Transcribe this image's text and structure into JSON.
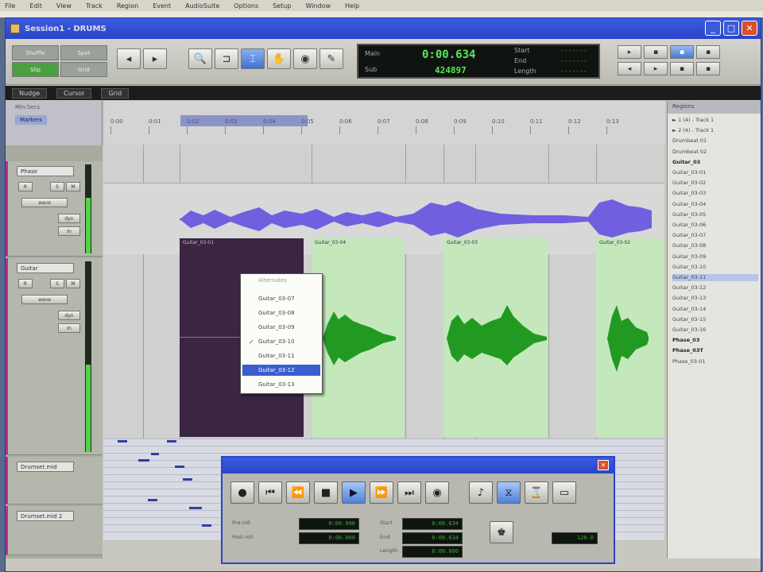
{
  "os_menu": [
    "File",
    "Edit",
    "View",
    "Track",
    "Region",
    "Event",
    "AudioSuite",
    "Options",
    "Setup",
    "Window",
    "Help"
  ],
  "window": {
    "title": "Session1 - DRUMS"
  },
  "toolbar": {
    "modes": [
      "Shuffle",
      "Spot",
      "Slip",
      "Grid"
    ],
    "counter_main_label": "Main",
    "counter_sub_label": "Sub",
    "counter_main": "0:00.634",
    "counter_sub": "424897",
    "start_label": "Start",
    "end_label": "End",
    "length_label": "Length"
  },
  "darkbar": {
    "items": [
      "Nudge",
      "Cursor",
      "Grid"
    ]
  },
  "ruler": {
    "labels": [
      "Min:Secs",
      "Markers"
    ],
    "ticks": [
      "0:00",
      "0:01",
      "0:02",
      "0:03",
      "0:04",
      "0:05",
      "0:06",
      "0:07",
      "0:08",
      "0:09",
      "0:10",
      "0:11",
      "0:12",
      "0:13"
    ]
  },
  "tracks": [
    {
      "name": "Phase",
      "button_r": "R",
      "button_s": "S",
      "button_m": "M"
    },
    {
      "name": "Guitar",
      "button_r": "R",
      "button_s": "S",
      "button_m": "M"
    },
    {
      "name": "Drumset.mid"
    },
    {
      "name": "Drumset.mid 2"
    }
  ],
  "regions": {
    "dark": "Guitar_03-01",
    "g1": "Guitar_03-04",
    "g2": "Guitar_03-03",
    "g3": "Guitar_03-02"
  },
  "popup": {
    "header": "Alternates",
    "items": [
      "Guitar_03-07",
      "Guitar_03-08",
      "Guitar_03-09",
      "Guitar_03-10",
      "Guitar_03-11",
      "Guitar_03-12",
      "Guitar_03-13"
    ],
    "checked_index": 3,
    "selected_index": 5
  },
  "region_list": {
    "header": "Regions",
    "items": [
      "► 1 (4) - Track 1",
      "► 2 (4) - Track 1",
      "Drumbeat 01",
      "Drumbeat 02",
      "Guitar_03",
      "Guitar_03-01",
      "Guitar_03-02",
      "Guitar_03-03",
      "Guitar_03-04",
      "Guitar_03-05",
      "Guitar_03-06",
      "Guitar_03-07",
      "Guitar_03-08",
      "Guitar_03-09",
      "Guitar_03-10",
      "Guitar_03-11",
      "Guitar_03-12",
      "Guitar_03-13",
      "Guitar_03-14",
      "Guitar_03-15",
      "Guitar_03-16",
      "Phase_03",
      "Phase_03T",
      "Phase_03-01"
    ]
  },
  "transport": {
    "lbl_pre": "Pre-roll",
    "lbl_post": "Post-roll",
    "lbl_start": "Start",
    "lbl_end": "End",
    "lbl_length": "Length",
    "pre_val": "0:00.000",
    "post_val": "0:00.000",
    "start_val": "0:00.634",
    "end_val": "0:00.634",
    "length_val": "0:00.000",
    "tempo_val": "120.0"
  }
}
